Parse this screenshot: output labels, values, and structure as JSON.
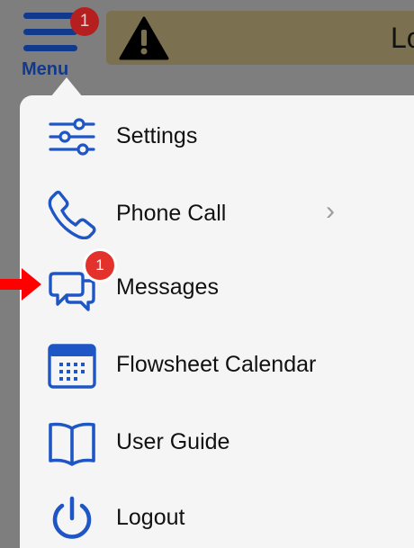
{
  "header": {
    "menu_label": "Menu",
    "menu_badge": "1",
    "banner_text": "Lo",
    "colors": {
      "nav_blue": "#123a8c",
      "badge_red": "#b51f1f"
    },
    "icons": {
      "menu": "hamburger-icon",
      "warning": "warning-triangle-icon"
    }
  },
  "menu": {
    "items": [
      {
        "label": "Settings",
        "icon": "sliders-icon"
      },
      {
        "label": "Phone Call",
        "icon": "phone-icon",
        "has_submenu": true
      },
      {
        "label": "Messages",
        "icon": "chat-bubbles-icon",
        "badge": "1"
      },
      {
        "label": "Flowsheet Calendar",
        "icon": "calendar-icon"
      },
      {
        "label": "User Guide",
        "icon": "book-icon"
      },
      {
        "label": "Logout",
        "icon": "power-icon"
      }
    ],
    "colors": {
      "icon_blue": "#1f56c5",
      "badge_red": "#e3322b",
      "panel": "#f5f5f5"
    }
  },
  "annotation": {
    "icon": "red-arrow-icon",
    "color": "#ff0000"
  }
}
